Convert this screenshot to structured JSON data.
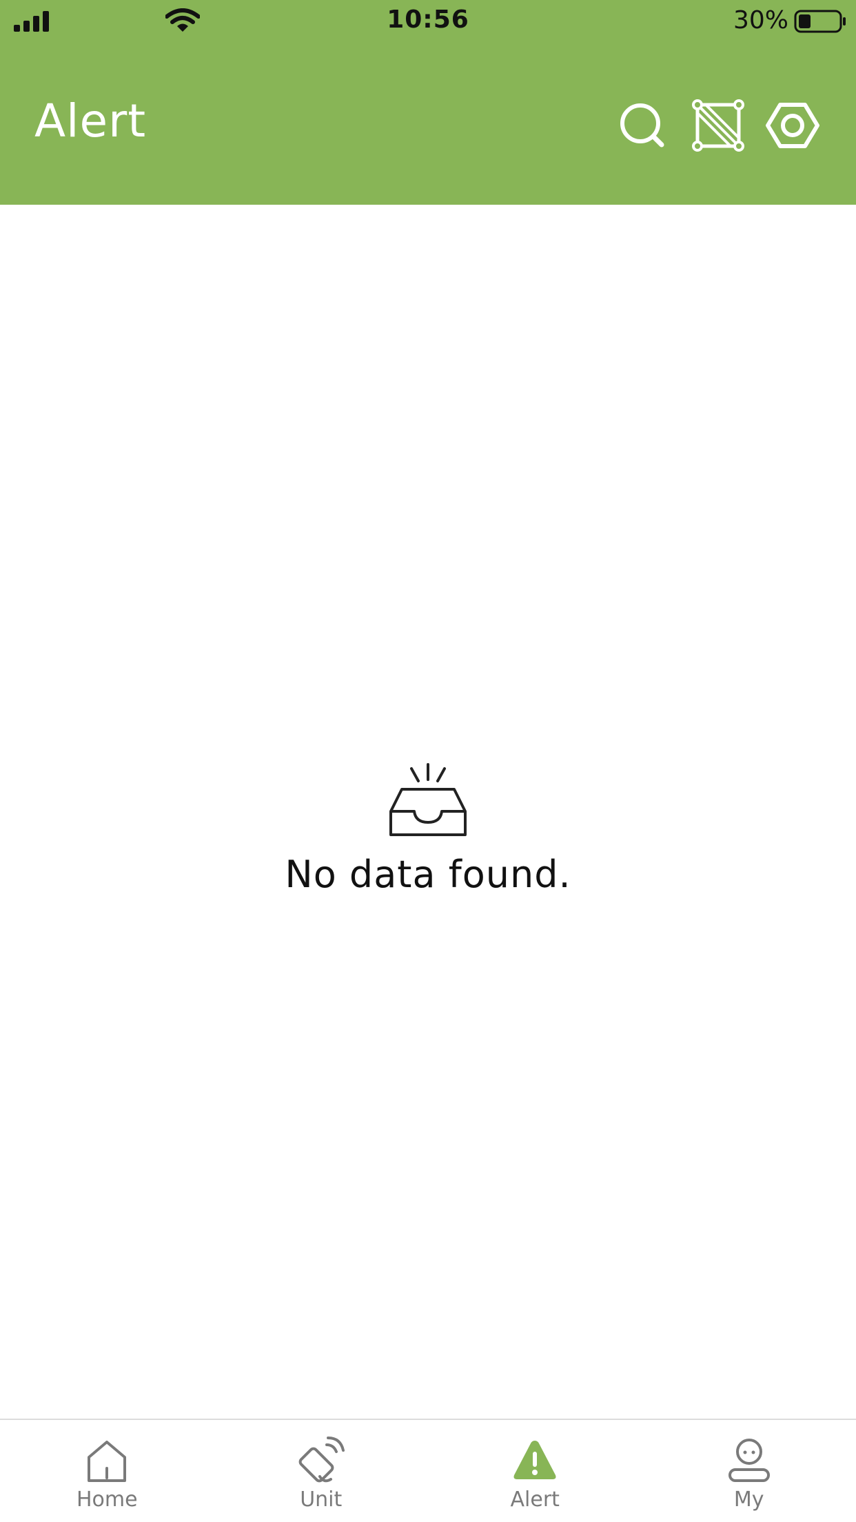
{
  "status_bar": {
    "time": "10:56",
    "battery_percent": "30%",
    "battery_level": 0.3
  },
  "header": {
    "title": "Alert",
    "icons": [
      "search-icon",
      "scan-icon",
      "settings-icon"
    ]
  },
  "empty_state": {
    "icon": "inbox-icon",
    "message": "No data found."
  },
  "tabs": [
    {
      "label": "Home",
      "icon": "home-icon",
      "active": false
    },
    {
      "label": "Unit",
      "icon": "unit-icon",
      "active": false
    },
    {
      "label": "Alert",
      "icon": "alert-icon",
      "active": true
    },
    {
      "label": "My",
      "icon": "user-icon",
      "active": false
    }
  ],
  "colors": {
    "brand": "#88b556",
    "tab_inactive": "#7a7a7a",
    "tab_active_icon": "#88b556"
  }
}
